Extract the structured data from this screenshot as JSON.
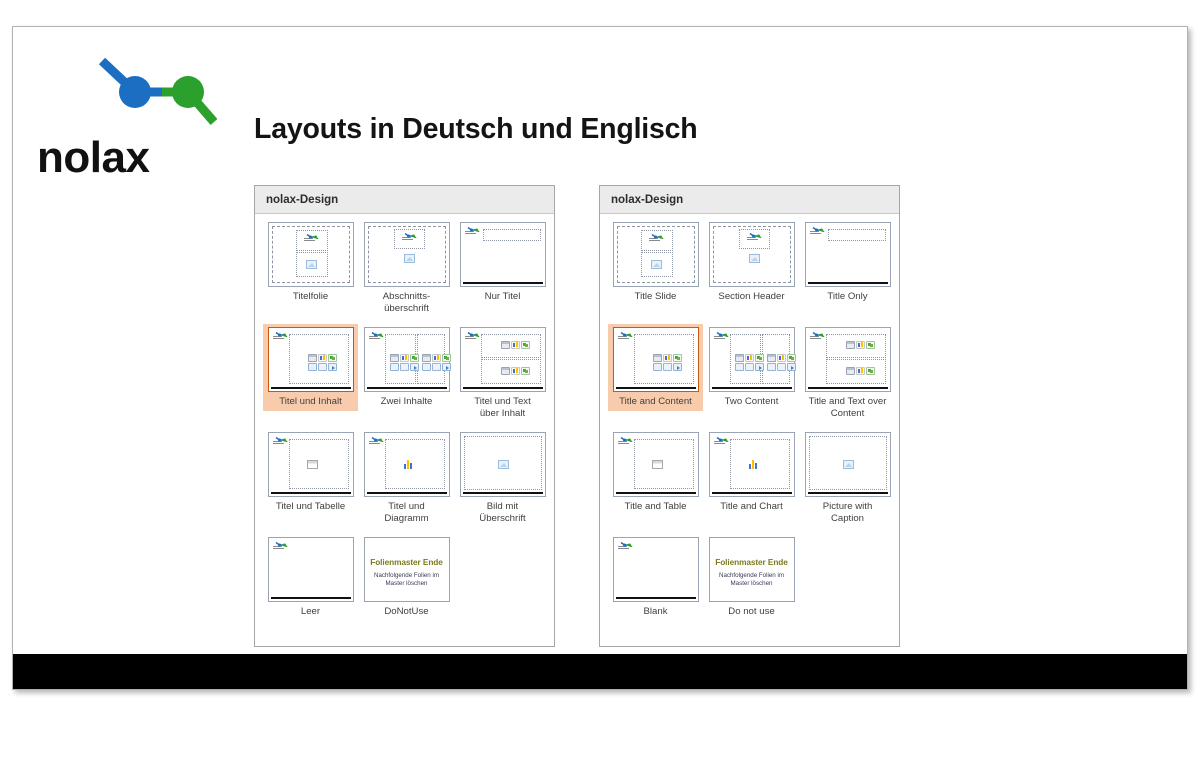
{
  "brand": {
    "logo_text": "nolax",
    "logo_blue": "#1b6ec2",
    "logo_green": "#2ca02c"
  },
  "slide": {
    "title": "Layouts in Deutsch und Englisch"
  },
  "panels": [
    {
      "id": "german",
      "header": "nolax-Design",
      "items": [
        {
          "label": "Titelfolie",
          "kind": "title-slide",
          "selected": false
        },
        {
          "label": "Abschnitts-\nüberschrift",
          "kind": "section",
          "selected": false
        },
        {
          "label": "Nur Titel",
          "kind": "title-only",
          "selected": false
        },
        {
          "label": "Titel und Inhalt",
          "kind": "content",
          "selected": true
        },
        {
          "label": "Zwei Inhalte",
          "kind": "two-content",
          "selected": false
        },
        {
          "label": "Titel und Text\nüber Inhalt",
          "kind": "text-over",
          "selected": false
        },
        {
          "label": "Titel und Tabelle",
          "kind": "table",
          "selected": false
        },
        {
          "label": "Titel und\nDiagramm",
          "kind": "chart",
          "selected": false
        },
        {
          "label": "Bild mit\nÜberschrift",
          "kind": "picture",
          "selected": false
        },
        {
          "label": "Leer",
          "kind": "blank",
          "selected": false
        },
        {
          "label": "DoNotUse",
          "kind": "donotuse",
          "selected": false
        }
      ]
    },
    {
      "id": "english",
      "header": "nolax-Design",
      "items": [
        {
          "label": "Title Slide",
          "kind": "title-slide",
          "selected": false
        },
        {
          "label": "Section Header",
          "kind": "section",
          "selected": false
        },
        {
          "label": "Title Only",
          "kind": "title-only",
          "selected": false
        },
        {
          "label": "Title and Content",
          "kind": "content",
          "selected": true
        },
        {
          "label": "Two Content",
          "kind": "two-content",
          "selected": false
        },
        {
          "label": "Title and Text over\nContent",
          "kind": "text-over",
          "selected": false
        },
        {
          "label": "Title and Table",
          "kind": "table",
          "selected": false
        },
        {
          "label": "Title and Chart",
          "kind": "chart",
          "selected": false
        },
        {
          "label": "Picture with\nCaption",
          "kind": "picture",
          "selected": false
        },
        {
          "label": "Blank",
          "kind": "blank",
          "selected": false
        },
        {
          "label": "Do not use",
          "kind": "donotuse",
          "selected": false
        }
      ]
    }
  ],
  "donotuse_slide": {
    "headline": "Folienmaster Ende",
    "body_line1": "Nachfolgende Folien im",
    "body_line2": "Master löschen",
    "headline_color": "#7d7a1f"
  },
  "selection": {
    "fill": "#f8cbad",
    "border": "#c55a11"
  }
}
